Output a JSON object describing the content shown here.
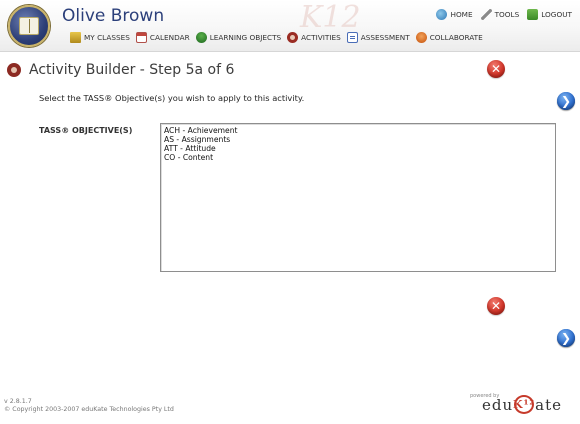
{
  "header": {
    "user_name": "Olive Brown",
    "watermark_text": "K12",
    "top_links": [
      {
        "label": "HOME",
        "icon": "home-icon"
      },
      {
        "label": "TOOLS",
        "icon": "tools-icon"
      },
      {
        "label": "LOGOUT",
        "icon": "logout-icon"
      }
    ],
    "nav": [
      {
        "label": "MY CLASSES",
        "icon": "classes-icon"
      },
      {
        "label": "CALENDAR",
        "icon": "calendar-icon"
      },
      {
        "label": "LEARNING OBJECTS",
        "icon": "learning-objects-icon"
      },
      {
        "label": "ACTIVITIES",
        "icon": "activities-icon"
      },
      {
        "label": "ASSESSMENT",
        "icon": "assessment-icon"
      },
      {
        "label": "COLLABORATE",
        "icon": "collaborate-icon"
      }
    ]
  },
  "page": {
    "title": "Activity Builder - Step 5a of 6",
    "instructions": "Select the TASS® Objective(s) you wish to apply to this activity."
  },
  "form": {
    "label": "TASS® OBJECTIVE(S)",
    "options": [
      "ACH - Achievement",
      "AS - Assignments",
      "ATT - Attitude",
      "CO - Content"
    ]
  },
  "footer": {
    "version": "v 2.8.1.7",
    "copyright": "© Copyright 2003-2007 eduKate Technologies Pty Ltd",
    "powered_by": "powered by",
    "logo_left": "edu",
    "logo_mid": "K¹²",
    "logo_right": "ate"
  },
  "colors": {
    "cancel": "#d2362a",
    "navigate": "#2f6fcf",
    "title": "#2b3f7a"
  }
}
